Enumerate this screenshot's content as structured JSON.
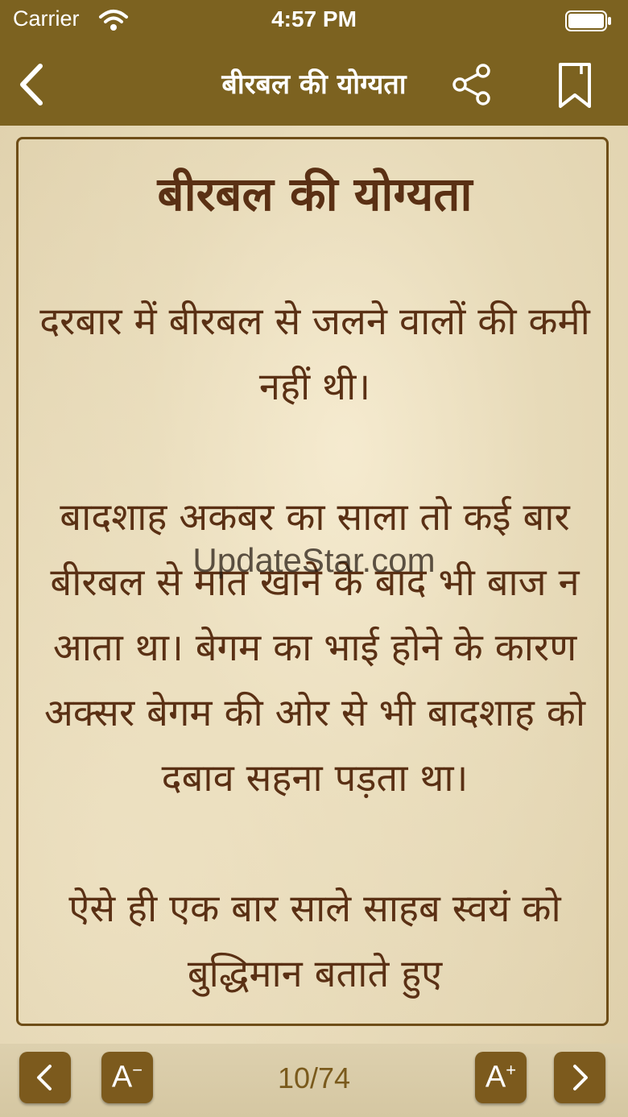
{
  "status_bar": {
    "carrier": "Carrier",
    "time": "4:57 PM"
  },
  "nav": {
    "title": "बीरबल की योग्यता",
    "back_icon": "chevron-left-icon",
    "share_icon": "share-icon",
    "bookmark_icon": "bookmark-icon"
  },
  "story": {
    "title": "बीरबल की योग्यता",
    "paragraphs": [
      "दरबार में बीरबल से जलने वालों की कमी नहीं थी।",
      "बादशाह अकबर का साला तो कई बार बीरबल से मात खाने के बाद भी बाज न आता था। बेगम का भाई होने के कारण अक्सर बेगम की ओर से भी बादशाह को दबाव सहना पड़ता था।",
      "ऐसे ही एक बार साले साहब स्वयं को बुद्धिमान बताते हुए"
    ]
  },
  "watermark": "UpdateStar.com",
  "bottom_bar": {
    "prev_icon": "chevron-left-icon",
    "font_decrease_label": "A",
    "font_decrease_sign": "−",
    "page_indicator": "10/74",
    "font_increase_label": "A",
    "font_increase_sign": "+",
    "next_icon": "chevron-right-icon"
  },
  "colors": {
    "bar": "#7c6220",
    "text": "#5a3014",
    "button": "#7c5a1d"
  }
}
